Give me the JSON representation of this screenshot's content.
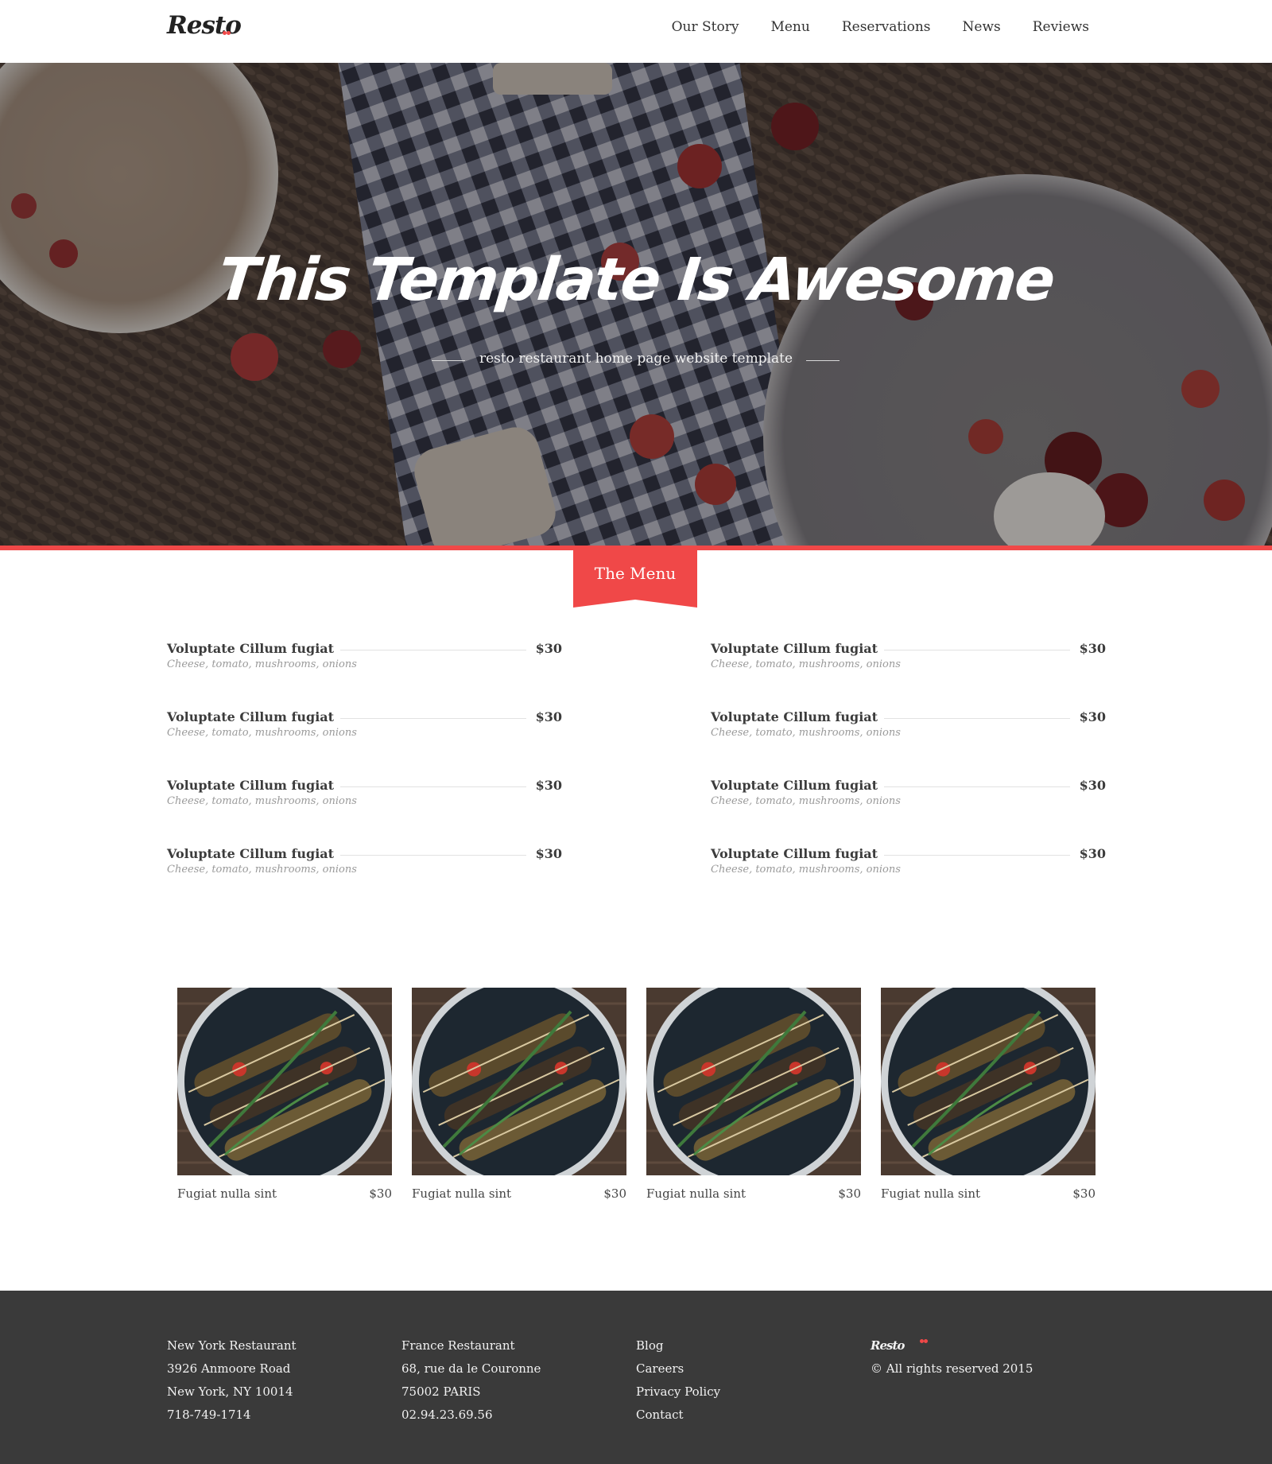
{
  "header": {
    "logo": "Resto",
    "nav": [
      "Our Story",
      "Menu",
      "Reservations",
      "News",
      "Reviews"
    ]
  },
  "hero": {
    "title": "This Template Is Awesome",
    "subtitle": "resto restaurant home page website template"
  },
  "menu_section": {
    "title": "The Menu",
    "left_items": [
      {
        "name": "Voluptate Cillum fugiat",
        "price": "$30",
        "desc": "Cheese, tomato, mushrooms, onions"
      },
      {
        "name": "Voluptate Cillum fugiat",
        "price": "$30",
        "desc": "Cheese, tomato, mushrooms, onions"
      },
      {
        "name": "Voluptate Cillum fugiat",
        "price": "$30",
        "desc": "Cheese, tomato, mushrooms, onions"
      },
      {
        "name": "Voluptate Cillum fugiat",
        "price": "$30",
        "desc": "Cheese, tomato, mushrooms, onions"
      }
    ],
    "right_items": [
      {
        "name": "Voluptate Cillum fugiat",
        "price": "$30",
        "desc": "Cheese, tomato, mushrooms, onions"
      },
      {
        "name": "Voluptate Cillum fugiat",
        "price": "$30",
        "desc": "Cheese, tomato, mushrooms, onions"
      },
      {
        "name": "Voluptate Cillum fugiat",
        "price": "$30",
        "desc": "Cheese, tomato, mushrooms, onions"
      },
      {
        "name": "Voluptate Cillum fugiat",
        "price": "$30",
        "desc": "Cheese, tomato, mushrooms, onions"
      }
    ]
  },
  "gallery": [
    {
      "name": "Fugiat nulla sint",
      "price": "$30"
    },
    {
      "name": "Fugiat nulla sint",
      "price": "$30"
    },
    {
      "name": "Fugiat nulla sint",
      "price": "$30"
    },
    {
      "name": "Fugiat nulla sint",
      "price": "$30"
    }
  ],
  "footer": {
    "col1": [
      "New York Restaurant",
      "3926 Anmoore Road",
      "New York, NY 10014",
      "718-749-1714"
    ],
    "col2": [
      "France Restaurant",
      "68, rue da le Couronne",
      "75002 PARIS",
      "02.94.23.69.56"
    ],
    "col3": [
      "Blog",
      "Careers",
      "Privacy Policy",
      "Contact"
    ],
    "logo": "Resto",
    "copyright": "© All rights reserved 2015"
  },
  "colors": {
    "accent": "#f04848",
    "footer_bg": "#3a3a3a",
    "hero_bg": "#3b3636"
  }
}
